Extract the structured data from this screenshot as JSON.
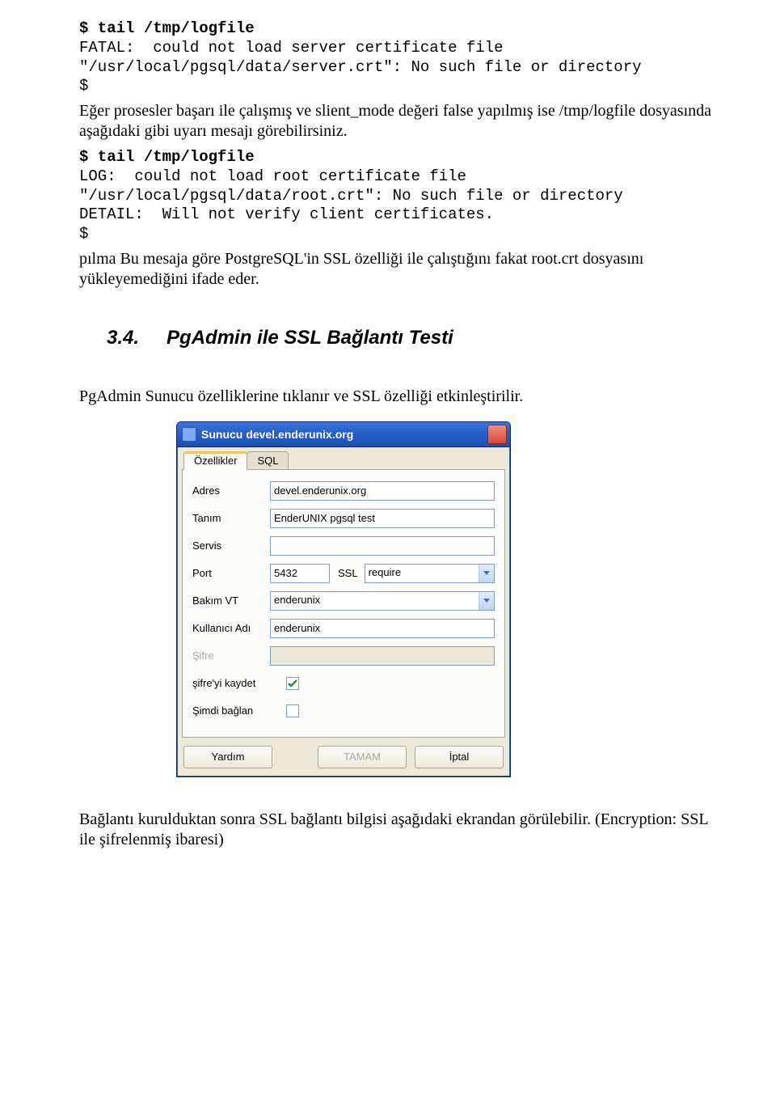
{
  "code1": {
    "l1a": "$",
    "l1b": " tail /tmp/logfile",
    "l2": "FATAL:  could not load server certificate file \"/usr/local/pgsql/data/server.crt\": No such file or directory",
    "l3": "$"
  },
  "para1": "Eğer prosesler başarı ile çalışmış ve slient_mode değeri false yapılmış ise /tmp/logfile dosyasında aşağıdaki gibi uyarı mesajı görebilirsiniz.",
  "code2": {
    "l1a": "$",
    "l1b": " tail /tmp/logfile",
    "l2": "LOG:  could not load root certificate file \"/usr/local/pgsql/data/root.crt\": No such file or directory",
    "l3": "DETAIL:  Will not verify client certificates.",
    "l4": "$"
  },
  "para2": "pılma Bu mesaja göre PostgreSQL'in SSL özelliği ile çalıştığını fakat root.crt dosyasını yükleyemediğini ifade eder.",
  "heading": {
    "num": "3.4.",
    "text": "PgAdmin ile SSL Bağlantı Testi"
  },
  "para3": "PgAdmin Sunucu özelliklerine tıklanır ve SSL özelliği etkinleştirilir.",
  "dialog": {
    "title": "Sunucu devel.enderunix.org",
    "tabs": {
      "t1": "Özellikler",
      "t2": "SQL"
    },
    "labels": {
      "adres": "Adres",
      "tanim": "Tanım",
      "servis": "Servis",
      "port": "Port",
      "ssl": "SSL",
      "bakimvt": "Bakım VT",
      "kullanici": "Kullanıcı Adı",
      "sifre": "Şifre",
      "sifrekaydet": "şifre'yi kaydet",
      "simdibaglan": "Şimdi bağlan"
    },
    "values": {
      "adres": "devel.enderunix.org",
      "tanim": "EnderUNIX pgsql test",
      "servis": "",
      "port": "5432",
      "ssl": "require",
      "bakimvt": "enderunix",
      "kullanici": "enderunix",
      "sifre": ""
    },
    "checked": {
      "sifrekaydet": true,
      "simdibaglan": false
    },
    "buttons": {
      "yardim": "Yardım",
      "tamam": "TAMAM",
      "iptal": "İptal"
    }
  },
  "para4": "Bağlantı kurulduktan sonra SSL bağlantı bilgisi aşağıdaki ekrandan görülebilir. (Encryption: SSL ile şifrelenmiş ibaresi)"
}
